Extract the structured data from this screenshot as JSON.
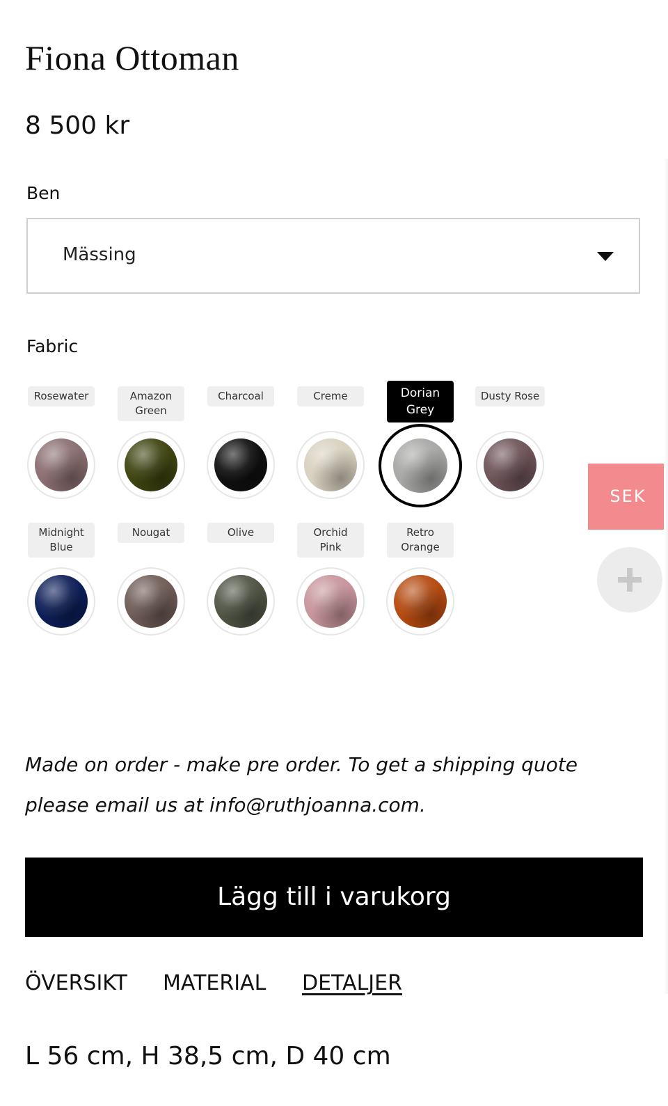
{
  "product": {
    "title": "Fiona Ottoman",
    "price": "8 500 kr"
  },
  "options": {
    "legs_label": "Ben",
    "legs_value": "Mässing",
    "fabric_label": "Fabric"
  },
  "fabrics": [
    {
      "line1": "Rosewater",
      "line2": "",
      "color": "#8b6f72",
      "selected": false
    },
    {
      "line1": "Amazon",
      "line2": "Green",
      "color": "#3f4410",
      "selected": false
    },
    {
      "line1": "Charcoal",
      "line2": "",
      "color": "#101010",
      "selected": false
    },
    {
      "line1": "Creme",
      "line2": "",
      "color": "#d8d1bf",
      "selected": false
    },
    {
      "line1": "Dorian",
      "line2": "Grey",
      "color": "#a7a8a6",
      "selected": true
    },
    {
      "line1": "Dusty Rose",
      "line2": "",
      "color": "#6e5459",
      "selected": false
    },
    {
      "line1": "Midnight",
      "line2": "Blue",
      "color": "#0c1e58",
      "selected": false
    },
    {
      "line1": "Nougat",
      "line2": "",
      "color": "#6f5c56",
      "selected": false
    },
    {
      "line1": "Olive",
      "line2": "",
      "color": "#4f5443",
      "selected": false
    },
    {
      "line1": "Orchid",
      "line2": "Pink",
      "color": "#c7959b",
      "selected": false
    },
    {
      "line1": "Retro",
      "line2": "Orange",
      "color": "#b54a10",
      "selected": false
    }
  ],
  "note": "Made on order - make pre order. To get a shipping quote please email us at info@ruthjoanna.com.",
  "cart_button": "Lägg till i varukorg",
  "tabs": [
    {
      "label": "ÖVERSIKT",
      "active": false
    },
    {
      "label": "MATERIAL",
      "active": false
    },
    {
      "label": "DETALJER",
      "active": true
    }
  ],
  "dimensions": "L 56 cm, H 38,5 cm, D 40 cm",
  "currency_button": "SEK",
  "plus_icon": "plus-icon"
}
